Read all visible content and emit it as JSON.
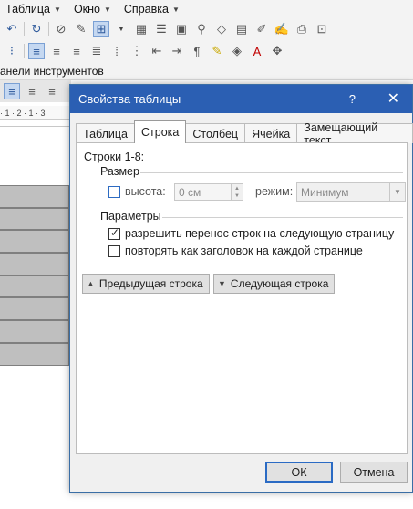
{
  "menubar": {
    "items": [
      "Таблица",
      "Окно",
      "Справка"
    ]
  },
  "toolbar_label": "анели инструментов",
  "ruler": {
    "text": "· 1 · 2 · 1 · 3"
  },
  "dialog": {
    "title": "Свойства таблицы",
    "help": "?",
    "close": "✕",
    "tabs": [
      "Таблица",
      "Строка",
      "Столбец",
      "Ячейка",
      "Замещающий текст"
    ],
    "active_tab": "Строка",
    "rows_label": "Строки 1-8:",
    "size_group": "Размер",
    "height_label": "высота:",
    "height_value": "0 см",
    "mode_label": "режим:",
    "mode_value": "Минимум",
    "params_group": "Параметры",
    "allow_break_label": "разрешить перенос строк на следующую страницу",
    "allow_break_checked": true,
    "repeat_header_label": "повторять как заголовок на каждой странице",
    "repeat_header_checked": false,
    "prev_row": "Предыдущая строка",
    "next_row": "Следующая строка",
    "ok": "ОК",
    "cancel": "Отмена"
  }
}
